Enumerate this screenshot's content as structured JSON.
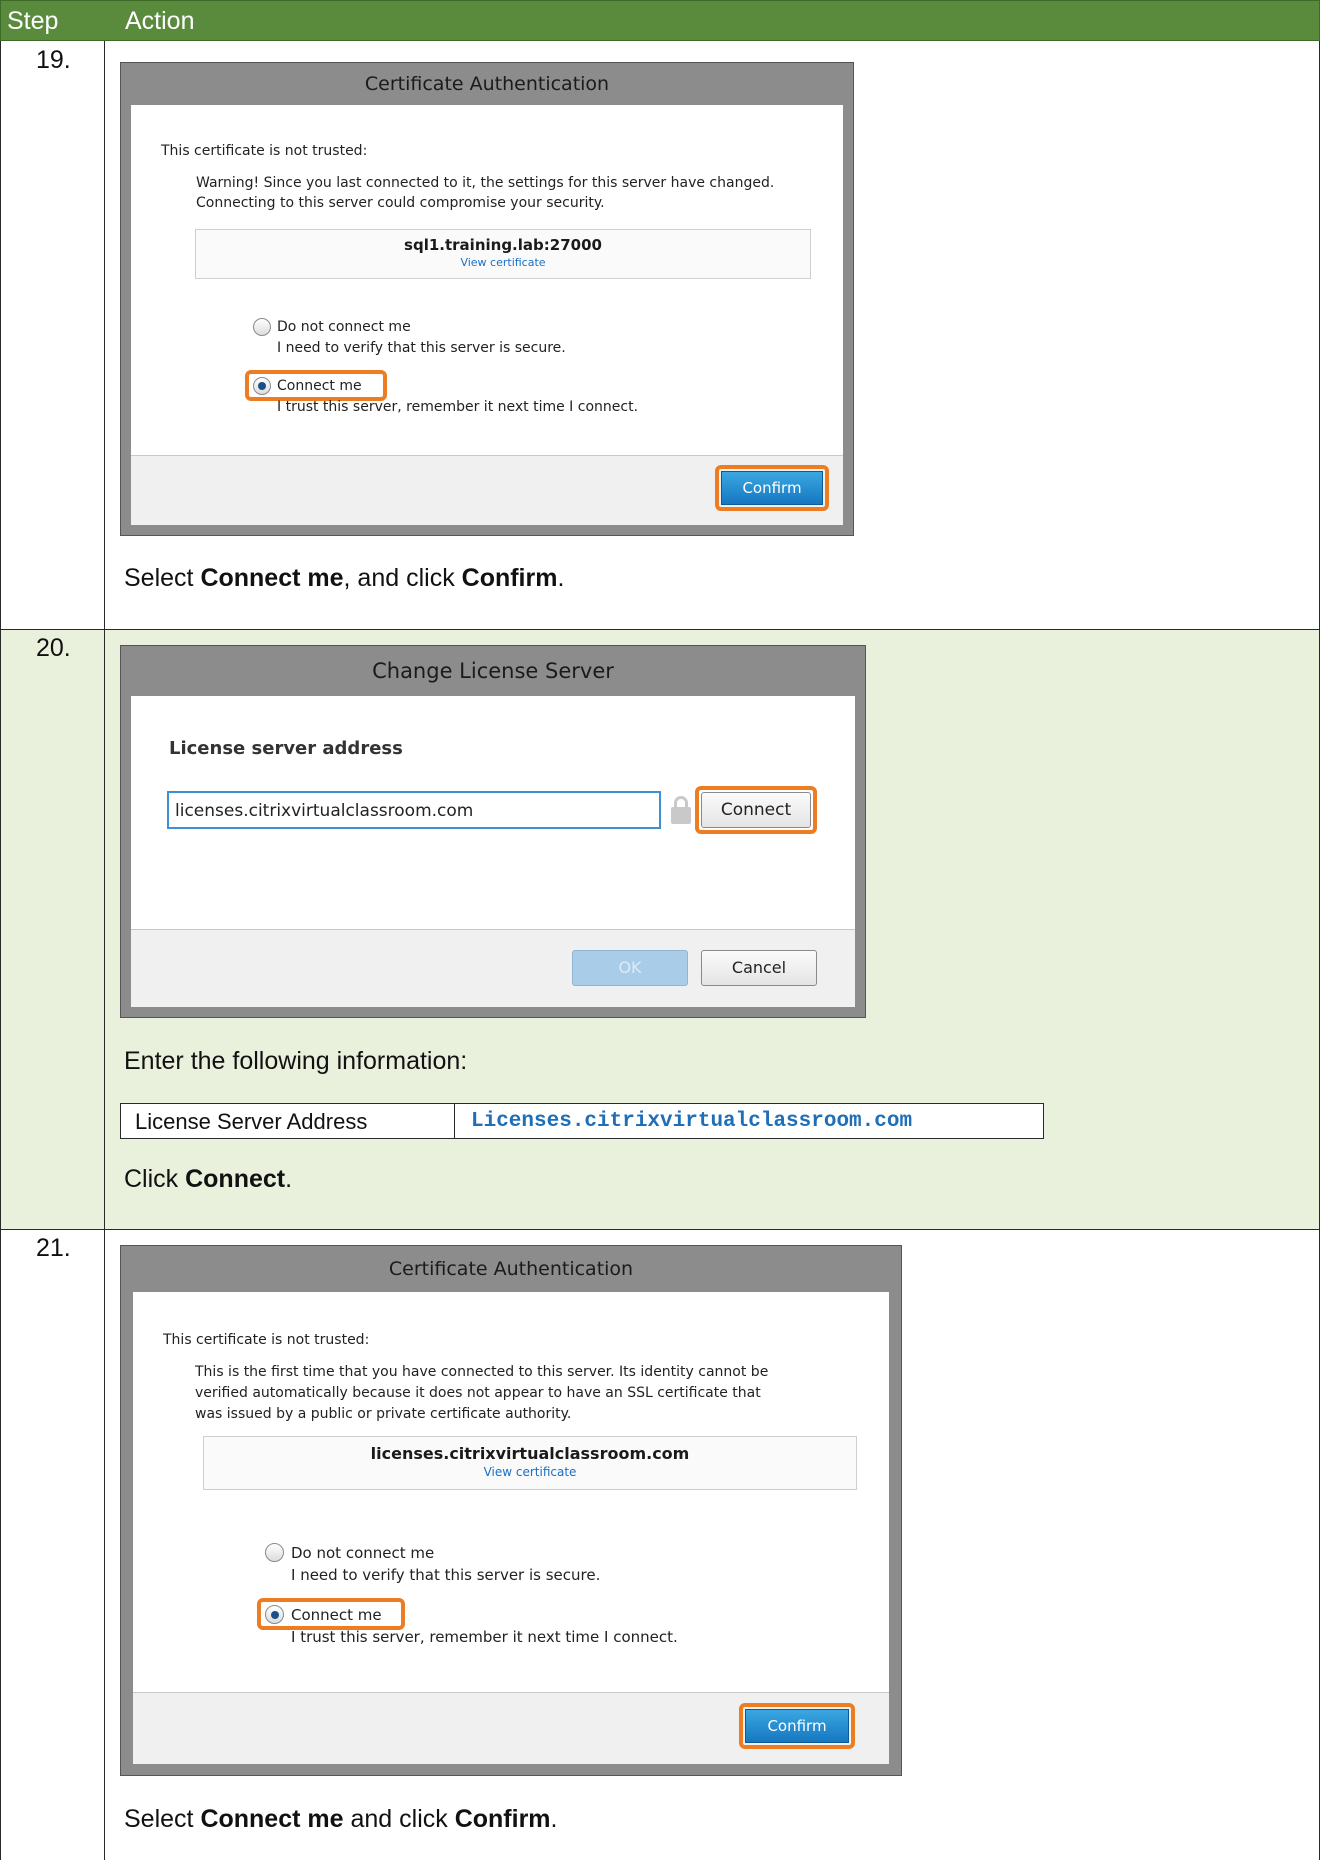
{
  "header": {
    "step": "Step",
    "action": "Action"
  },
  "rows": [
    {
      "step": "19.",
      "dialog": {
        "title": "Certificate Authentication",
        "not_trusted": "This certificate is not trusted:",
        "warning_lines": [
          "Warning! Since you last connected to it, the settings for this server have changed.",
          "Connecting to this server could compromise your security."
        ],
        "host": "sql1.training.lab:27000",
        "view_certificate": "View certificate",
        "option1_label": "Do not connect me",
        "option1_desc": "I need to verify that this server is secure.",
        "option2_label": "Connect me",
        "option2_desc": "I trust this server, remember it next time I connect.",
        "confirm_label": "Confirm"
      },
      "instruction": {
        "pre": "Select ",
        "b1": "Connect me",
        "mid": ", and click ",
        "b2": "Confirm",
        "post": "."
      }
    },
    {
      "step": "20.",
      "dialog": {
        "title": "Change License Server",
        "address_label": "License server address",
        "address_value": "licenses.citrixvirtualclassroom.com",
        "connect_label": "Connect",
        "ok_label": "OK",
        "cancel_label": "Cancel"
      },
      "intro": "Enter the following information:",
      "info_table": {
        "label": "License Server Address",
        "value": "Licenses.citrixvirtualclassroom.com"
      },
      "instruction": {
        "pre": "Click ",
        "b1": "Connect",
        "post": "."
      }
    },
    {
      "step": "21.",
      "dialog": {
        "title": "Certificate Authentication",
        "not_trusted": "This certificate is not trusted:",
        "warning_lines": [
          "This is the first time that you have connected to this server. Its identity cannot be",
          "verified automatically because it does not appear to have an SSL certificate that",
          "was issued by a public or private certificate authority."
        ],
        "host": "licenses.citrixvirtualclassroom.com",
        "view_certificate": "View certificate",
        "option1_label": "Do not connect me",
        "option1_desc": "I need to verify that this server is secure.",
        "option2_label": "Connect me",
        "option2_desc": "I trust this server, remember it next time I connect.",
        "confirm_label": "Confirm"
      },
      "instruction": {
        "pre": "Select ",
        "b1": "Connect me",
        "mid": " and click ",
        "b2": "Confirm",
        "post": "."
      }
    }
  ],
  "colors": {
    "header_bg": "#5a8b3c",
    "row_highlight": "#e9f1dd",
    "callout": "#ed7d22",
    "confirm_btn": "#1577c0",
    "link": "#1a6fc4"
  }
}
